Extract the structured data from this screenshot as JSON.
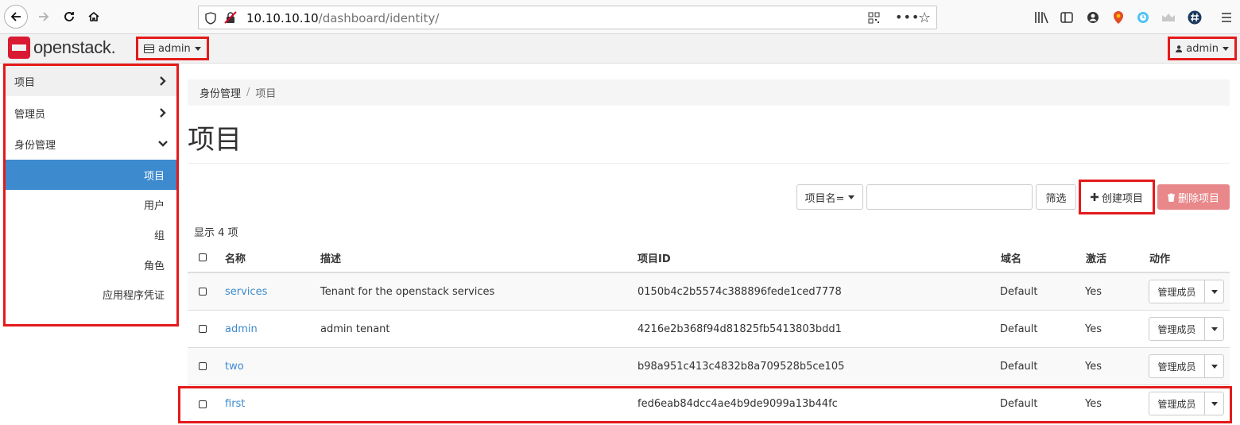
{
  "browser": {
    "url_host": "10.10.10.10",
    "url_path": "/dashboard/identity/"
  },
  "header": {
    "logo_text": "openstack.",
    "project_selector": "admin",
    "user_menu": "admin"
  },
  "sidebar": {
    "items": [
      {
        "label": "项目"
      },
      {
        "label": "管理员"
      },
      {
        "label": "身份管理"
      }
    ],
    "sub_items": [
      {
        "label": "项目"
      },
      {
        "label": "用户"
      },
      {
        "label": "组"
      },
      {
        "label": "角色"
      },
      {
        "label": "应用程序凭证"
      }
    ]
  },
  "breadcrumb": {
    "parent": "身份管理",
    "separator": "/",
    "current": "项目"
  },
  "page": {
    "title": "项目"
  },
  "toolbar": {
    "filter_field": "项目名=",
    "filter_value": "",
    "filter_button": "筛选",
    "create_button": "创建项目",
    "delete_button": "删除项目"
  },
  "table": {
    "count_text": "显示 4 项",
    "columns": [
      "名称",
      "描述",
      "项目ID",
      "域名",
      "激活",
      "动作"
    ],
    "rows": [
      {
        "name": "services",
        "description": "Tenant for the openstack services",
        "id": "0150b4c2b5574c388896fede1ced7778",
        "domain": "Default",
        "enabled": "Yes",
        "action": "管理成员"
      },
      {
        "name": "admin",
        "description": "admin tenant",
        "id": "4216e2b368f94d81825fb5413803bdd1",
        "domain": "Default",
        "enabled": "Yes",
        "action": "管理成员"
      },
      {
        "name": "two",
        "description": "",
        "id": "b98a951c413c4832b8a709528b5ce105",
        "domain": "Default",
        "enabled": "Yes",
        "action": "管理成员"
      },
      {
        "name": "first",
        "description": "",
        "id": "fed6eab84dcc4ae4b9de9099a13b44fc",
        "domain": "Default",
        "enabled": "Yes",
        "action": "管理成员"
      }
    ]
  },
  "colors": {
    "accent_blue": "#3d8acf",
    "highlight_red": "#e51a1a",
    "danger_button": "#e8888a",
    "brand_red": "#da1a32"
  }
}
